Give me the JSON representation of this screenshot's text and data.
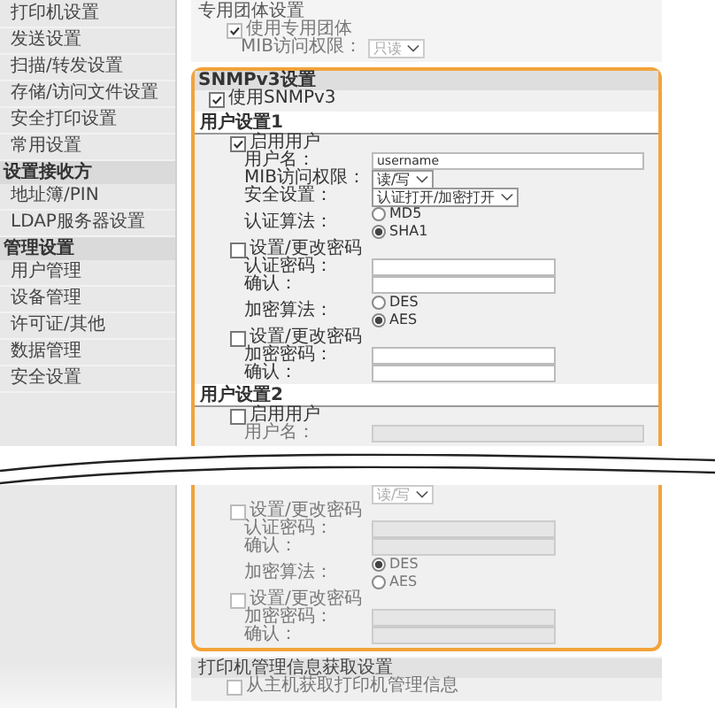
{
  "sidebar": {
    "items": [
      {
        "label": "打印机设置",
        "kind": "item"
      },
      {
        "label": "发送设置",
        "kind": "item"
      },
      {
        "label": "扫描/转发设置",
        "kind": "item"
      },
      {
        "label": "存储/访问文件设置",
        "kind": "item"
      },
      {
        "label": "安全打印设置",
        "kind": "item"
      },
      {
        "label": "常用设置",
        "kind": "item"
      },
      {
        "label": "设置接收方",
        "kind": "header"
      },
      {
        "label": "地址簿/PIN",
        "kind": "item"
      },
      {
        "label": "LDAP服务器设置",
        "kind": "item"
      },
      {
        "label": "管理设置",
        "kind": "header"
      },
      {
        "label": "用户管理",
        "kind": "item"
      },
      {
        "label": "设备管理",
        "kind": "item"
      },
      {
        "label": "许可证/其他",
        "kind": "item"
      },
      {
        "label": "数据管理",
        "kind": "item"
      },
      {
        "label": "安全设置",
        "kind": "item"
      }
    ]
  },
  "community": {
    "title": "专用团体设置",
    "rows": [
      {
        "kind": "check",
        "label": "使用专用团体",
        "checked": true,
        "disabled": true
      },
      {
        "kind": "select",
        "label": "MIB访问权限：",
        "value": "只读",
        "disabled": true
      }
    ]
  },
  "snmpv3": {
    "title": "SNMPv3设置",
    "use": {
      "label": "使用SNMPv3",
      "checked": true
    }
  },
  "users": [
    {
      "title": "用户设置1",
      "rows": [
        {
          "kind": "check",
          "label": "启用用户",
          "checked": true,
          "disabled": false
        },
        {
          "kind": "text",
          "label": "用户名：",
          "value": "username",
          "disabled": false
        },
        {
          "kind": "select",
          "label": "MIB访问权限：",
          "value": "读/写",
          "disabled": false
        },
        {
          "kind": "select",
          "label": "安全设置：",
          "value": "认证打开/加密打开",
          "disabled": false
        },
        {
          "kind": "radio",
          "label": "认证算法：",
          "disabled": false,
          "options": [
            {
              "label": "MD5",
              "selected": false
            },
            {
              "label": "SHA1",
              "selected": true
            }
          ]
        },
        {
          "kind": "check",
          "label": "设置/更改密码",
          "checked": false,
          "disabled": false
        },
        {
          "kind": "field",
          "label": "认证密码：",
          "disabled": false
        },
        {
          "kind": "field",
          "label": "确认：",
          "disabled": false
        },
        {
          "kind": "radio",
          "label": "加密算法：",
          "disabled": false,
          "options": [
            {
              "label": "DES",
              "selected": false
            },
            {
              "label": "AES",
              "selected": true
            }
          ]
        },
        {
          "kind": "check",
          "label": "设置/更改密码",
          "checked": false,
          "disabled": false
        },
        {
          "kind": "field",
          "label": "加密密码：",
          "disabled": false
        },
        {
          "kind": "field",
          "label": "确认：",
          "disabled": false
        }
      ]
    },
    {
      "title": "用户设置2",
      "rows": [
        {
          "kind": "check",
          "label": "启用用户",
          "checked": false,
          "disabled": false
        },
        {
          "kind": "text",
          "label": "用户名：",
          "disabled": true
        }
      ],
      "rows_after": [
        {
          "kind": "select",
          "value": "读/写",
          "disabled": true
        },
        {
          "kind": "check",
          "label": "设置/更改密码",
          "checked": false,
          "disabled": true
        },
        {
          "kind": "field",
          "label": "认证密码：",
          "disabled": true
        },
        {
          "kind": "field",
          "label": "确认：",
          "disabled": true
        },
        {
          "kind": "radio",
          "label": "加密算法：",
          "disabled": true,
          "options": [
            {
              "label": "DES",
              "selected": true
            },
            {
              "label": "AES",
              "selected": false
            }
          ]
        },
        {
          "kind": "check",
          "label": "设置/更改密码",
          "checked": false,
          "disabled": true
        },
        {
          "kind": "field",
          "label": "加密密码：",
          "disabled": true
        },
        {
          "kind": "field",
          "label": "确认：",
          "disabled": true
        }
      ]
    }
  ],
  "printer_mgmt": {
    "title": "打印机管理信息获取设置",
    "rows": [
      {
        "kind": "check",
        "label": "从主机获取打印机管理信息",
        "checked": false,
        "disabled": true
      }
    ]
  }
}
